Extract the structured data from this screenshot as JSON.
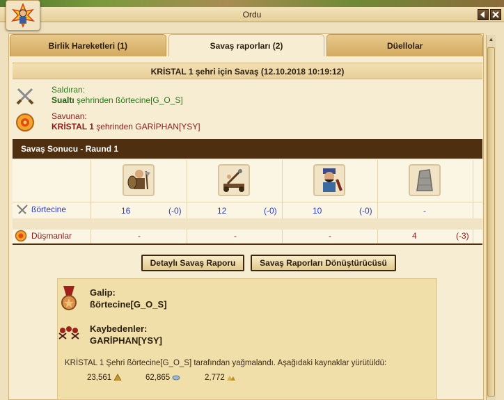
{
  "window": {
    "title": "Ordu"
  },
  "tabs": [
    {
      "label": "Birlik Hareketleri (1)"
    },
    {
      "label": "Savaş raporları (2)"
    },
    {
      "label": "Düellolar"
    }
  ],
  "report": {
    "title": "KRİSTAL 1 şehri için Savaş (12.10.2018 10:19:12)",
    "attacker": {
      "label": "Saldıran:",
      "city": "Sualtı",
      "from_text": " şehrinden ",
      "player": "ßörtecine[G_O_S]"
    },
    "defender": {
      "label": "Savunan:",
      "city": "KRİSTAL 1",
      "from_text": " şehrinden ",
      "player": "GARİPHAN[YSY]"
    }
  },
  "result": {
    "header": "Savaş Sonucu - Raund 1",
    "units": [
      "axe-warrior",
      "catapult",
      "swordsman",
      "wall"
    ],
    "rows": [
      {
        "name": "ßörtecine",
        "cells": [
          [
            "16",
            "(-0)"
          ],
          [
            "12",
            "(-0)"
          ],
          [
            "10",
            "(-0)"
          ],
          [
            "-",
            ""
          ]
        ]
      },
      {
        "name": "Düşmanlar",
        "cells": [
          [
            "-",
            ""
          ],
          [
            "-",
            ""
          ],
          [
            "-",
            ""
          ],
          [
            "4",
            "(-3)"
          ]
        ]
      }
    ]
  },
  "buttons": {
    "detail": "Detaylı Savaş Raporu",
    "converter": "Savaş Raporları Dönüştürücüsü"
  },
  "summary": {
    "winner_label": "Galip:",
    "winner": "ßörtecine[G_O_S]",
    "losers_label": "Kaybedenler:",
    "loser": "GARİPHAN[YSY]",
    "loot_text": "KRİSTAL 1 Şehri ßörtecine[G_O_S] tarafından yağmalandı. Aşağıdaki kaynaklar yürütüldü:",
    "resources": [
      {
        "amount": "23,561",
        "icon": "grain-icon"
      },
      {
        "amount": "62,865",
        "icon": "coin-icon"
      },
      {
        "amount": "2,772",
        "icon": "stone-icon"
      }
    ]
  },
  "colors": {
    "accent": "#4e2f10",
    "attacker": "#2a7a1a",
    "defender": "#8b1a1a",
    "troops": "#2a3ad0"
  }
}
